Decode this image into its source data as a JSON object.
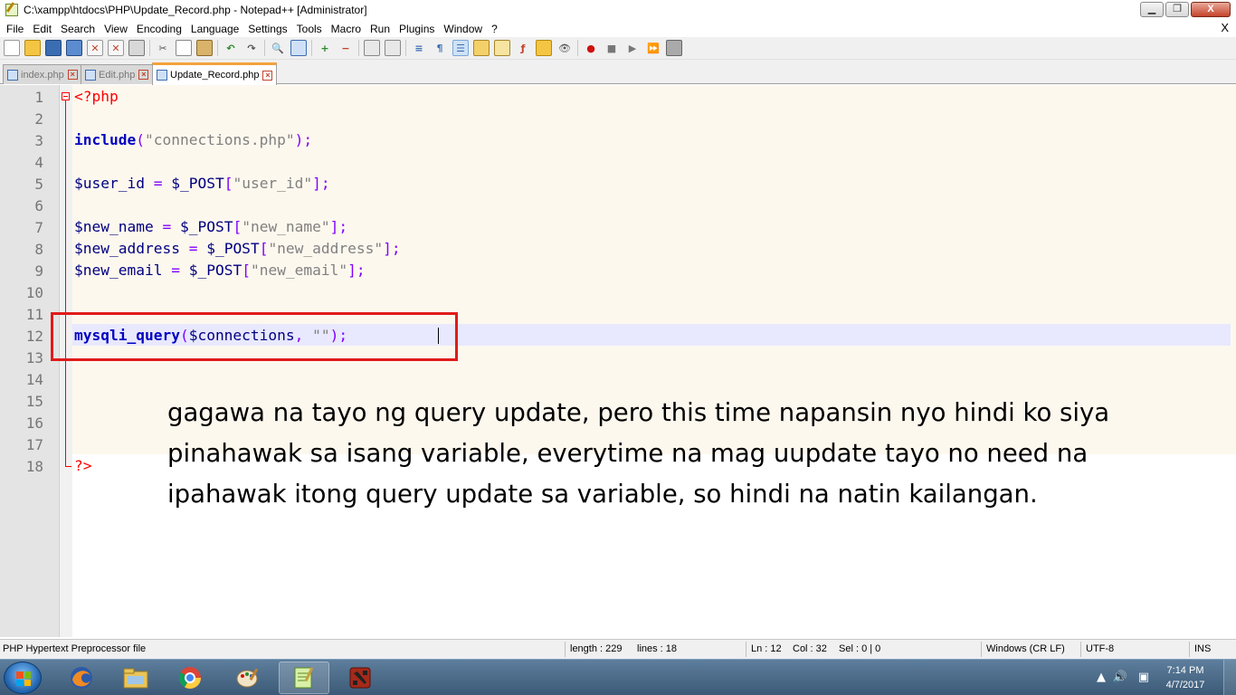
{
  "window": {
    "title": "C:\\xampp\\htdocs\\PHP\\Update_Record.php - Notepad++ [Administrator]",
    "buttons": {
      "minimize": "▁",
      "maximize": "❐",
      "close": "X"
    }
  },
  "menu": {
    "items": [
      "File",
      "Edit",
      "Search",
      "View",
      "Encoding",
      "Language",
      "Settings",
      "Tools",
      "Macro",
      "Run",
      "Plugins",
      "Window",
      "?"
    ],
    "close_label": "X"
  },
  "toolbar": {
    "icons": [
      "new-file-icon",
      "open-file-icon",
      "save-icon",
      "save-all-icon",
      "close-icon",
      "close-all-icon",
      "print-icon",
      "cut-icon",
      "copy-icon",
      "paste-icon",
      "undo-icon",
      "redo-icon",
      "find-icon",
      "replace-icon",
      "zoom-in-icon",
      "zoom-out-icon",
      "sync-vertical-icon",
      "sync-horizontal-icon",
      "word-wrap-icon",
      "show-all-chars-icon",
      "indent-guide-icon",
      "user-lang-icon",
      "doc-map-icon",
      "function-list-icon",
      "folder-workspace-icon",
      "monitoring-icon",
      "record-macro-icon",
      "stop-macro-icon",
      "play-macro-icon",
      "run-macro-multiple-icon",
      "save-macro-icon"
    ]
  },
  "tabs": [
    {
      "label": "index.php",
      "active": false
    },
    {
      "label": "Edit.php",
      "active": false
    },
    {
      "label": "Update_Record.php",
      "active": true
    }
  ],
  "editor": {
    "line_numbers": [
      "1",
      "2",
      "3",
      "4",
      "5",
      "6",
      "7",
      "8",
      "9",
      "10",
      "11",
      "12",
      "13",
      "14",
      "15",
      "16",
      "17",
      "18"
    ],
    "lines": {
      "l1_tag": "<?php",
      "l3_kw": "include",
      "l3_open": "(",
      "l3_str": "\"connections.php\"",
      "l3_close": ");",
      "l5_var": "$user_id",
      "l5_eq": " = ",
      "l5_post": "$_POST",
      "l5_ob": "[",
      "l5_str": "\"user_id\"",
      "l5_cb": "];",
      "l7_var": "$new_name",
      "l7_eq": " = ",
      "l7_post": "$_POST",
      "l7_ob": "[",
      "l7_str": "\"new_name\"",
      "l7_cb": "];",
      "l8_var": "$new_address",
      "l8_eq": " = ",
      "l8_post": "$_POST",
      "l8_ob": "[",
      "l8_str": "\"new_address\"",
      "l8_cb": "];",
      "l9_var": "$new_email",
      "l9_eq": " = ",
      "l9_post": "$_POST",
      "l9_ob": "[",
      "l9_str": "\"new_email\"",
      "l9_cb": "];",
      "l12_kw": "mysqli_query",
      "l12_open": "(",
      "l12_var": "$connections",
      "l12_comma": ", ",
      "l12_str": "\"\"",
      "l12_close": ");",
      "l18_tag": "?>"
    }
  },
  "annotation": {
    "text": "gagawa na tayo ng query update, pero this time napansin nyo hindi ko siya pinahawak sa isang variable, everytime na mag uupdate tayo no need na ipahawak itong query update sa variable, so hindi na natin kailangan."
  },
  "statusbar": {
    "file_type": "PHP Hypertext Preprocessor file",
    "length": "length : 229",
    "lines": "lines : 18",
    "ln": "Ln : 12",
    "col": "Col : 32",
    "sel": "Sel : 0 | 0",
    "eol": "Windows (CR LF)",
    "encoding": "UTF-8",
    "mode": "INS"
  },
  "taskbar": {
    "apps": [
      "firefox-icon",
      "file-explorer-icon",
      "chrome-icon",
      "paint-icon",
      "notepad-plus-plus-icon",
      "dota2-icon"
    ],
    "time": "7:14 PM",
    "date": "4/7/2017"
  },
  "colors": {
    "keyword": "#0000c0",
    "string": "#808080",
    "operator": "#8000ff",
    "php_tag": "#ff0000",
    "highlight_box": "#e01b1b"
  }
}
